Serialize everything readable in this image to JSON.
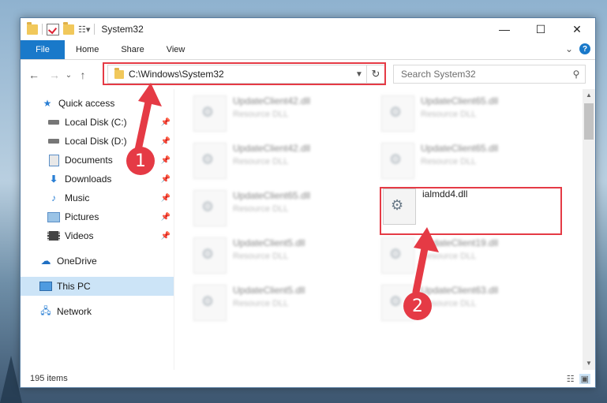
{
  "window": {
    "title": "System32",
    "minimize_label": "—",
    "maximize_label": "☐",
    "close_label": "✕"
  },
  "ribbon": {
    "tabs": [
      "File",
      "Home",
      "Share",
      "View"
    ],
    "expand_label": "⌄",
    "help_label": "?"
  },
  "nav": {
    "back_label": "←",
    "forward_label": "→",
    "recent_label": "⌄",
    "up_label": "↑",
    "address": "C:\\Windows\\System32",
    "refresh_label": "↻",
    "search_placeholder": "Search System32"
  },
  "sidebar": {
    "items": [
      {
        "label": "Quick access",
        "icon": "star-icon"
      },
      {
        "label": "Local Disk (C:)",
        "icon": "drive-icon",
        "pinned": true
      },
      {
        "label": "Local Disk (D:)",
        "icon": "drive-icon",
        "pinned": true
      },
      {
        "label": "Documents",
        "icon": "documents-icon",
        "pinned": true
      },
      {
        "label": "Downloads",
        "icon": "download-icon",
        "pinned": true
      },
      {
        "label": "Music",
        "icon": "music-icon",
        "pinned": true
      },
      {
        "label": "Pictures",
        "icon": "pictures-icon",
        "pinned": true
      },
      {
        "label": "Videos",
        "icon": "videos-icon",
        "pinned": true
      },
      {
        "label": "OneDrive",
        "icon": "cloud-icon"
      },
      {
        "label": "This PC",
        "icon": "computer-icon",
        "selected": true
      },
      {
        "label": "Network",
        "icon": "network-icon"
      }
    ]
  },
  "files": [
    {
      "name": "UpdateClient42.dll",
      "desc": "Resource DLL",
      "blurred": true
    },
    {
      "name": "UpdateClient65.dll",
      "desc": "Resource DLL",
      "blurred": true
    },
    {
      "name": "UpdateClient42.dll",
      "desc": "Resource DLL",
      "blurred": true
    },
    {
      "name": "UpdateClient65.dll",
      "desc": "Resource DLL",
      "blurred": true
    },
    {
      "name": "UpdateClient65.dll",
      "desc": "Resource DLL",
      "blurred": true
    },
    {
      "name": "ialmdd4.dll",
      "desc": "",
      "blurred": false
    },
    {
      "name": "UpdateClient5.dll",
      "desc": "Resource DLL",
      "blurred": true
    },
    {
      "name": "UpdateClient19.dll",
      "desc": "Resource DLL",
      "blurred": true
    },
    {
      "name": "UpdateClient5.dll",
      "desc": "Resource DLL",
      "blurred": true
    },
    {
      "name": "UpdateClient63.dll",
      "desc": "Resource DLL",
      "blurred": true
    }
  ],
  "status": {
    "item_count": "195 items"
  },
  "markers": [
    "1",
    "2"
  ],
  "colors": {
    "accent": "#1979ca",
    "highlight": "#e53a45",
    "selection": "#cce4f7"
  }
}
